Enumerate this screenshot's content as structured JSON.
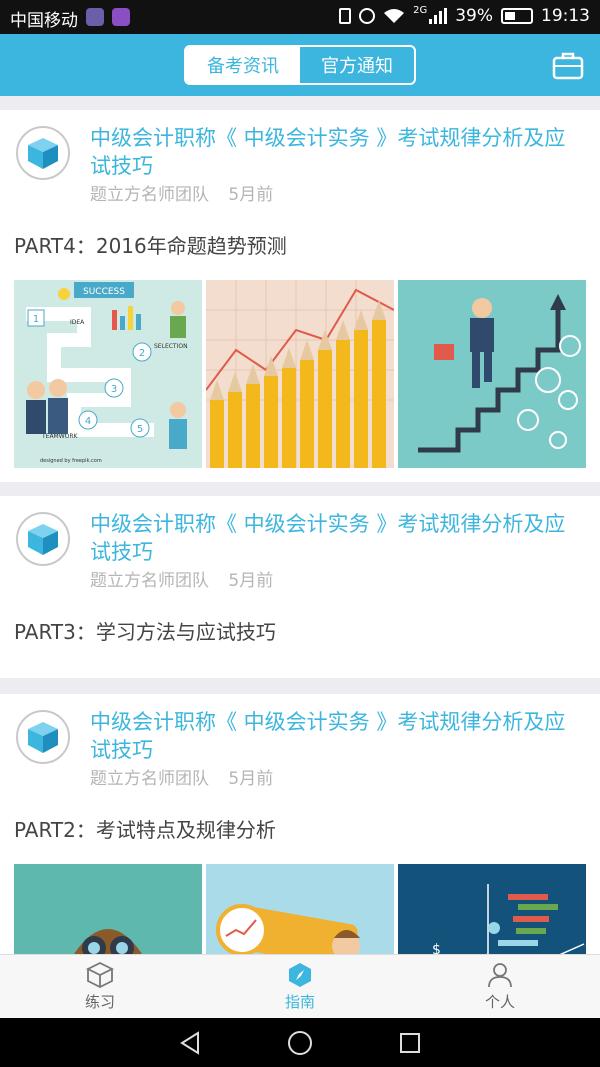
{
  "status_bar": {
    "carrier": "中国移动",
    "signal_tag": "2G",
    "battery": "39%",
    "time": "19:13"
  },
  "header": {
    "tabs": [
      {
        "label": "备考资讯",
        "active": true
      },
      {
        "label": "官方通知",
        "active": false
      }
    ],
    "accent_color": "#3cb6de"
  },
  "feed": {
    "cards": [
      {
        "title": "中级会计职称《 中级会计实务 》考试规律分析及应试技巧",
        "author": "题立方名师团队",
        "time": "5月前",
        "subtitle": "PART4：2016年命题趋势预测",
        "images": [
          "infographic",
          "pencils-chart",
          "businessman-stairs"
        ]
      },
      {
        "title": "中级会计职称《 中级会计实务 》考试规律分析及应试技巧",
        "author": "题立方名师团队",
        "time": "5月前",
        "subtitle": "PART3：学习方法与应试技巧"
      },
      {
        "title": "中级会计职称《 中级会计实务 》考试规律分析及应试技巧",
        "author": "题立方名师团队",
        "time": "5月前",
        "subtitle": "PART2：考试特点及规律分析",
        "images": [
          "binoculars",
          "telescope",
          "dark-analytics"
        ]
      }
    ],
    "image_texts": {
      "success": "SUCCESS",
      "idea": "IDEA",
      "selection": "SELECTION",
      "teamwork": "TEAMWORK",
      "steps": [
        "1",
        "2",
        "3",
        "4",
        "5"
      ],
      "credit": "designed by freepik.com"
    }
  },
  "bottom_nav": [
    {
      "label": "练习",
      "icon": "cube-icon",
      "active": false
    },
    {
      "label": "指南",
      "icon": "compass-icon",
      "active": true
    },
    {
      "label": "个人",
      "icon": "person-icon",
      "active": false
    }
  ]
}
